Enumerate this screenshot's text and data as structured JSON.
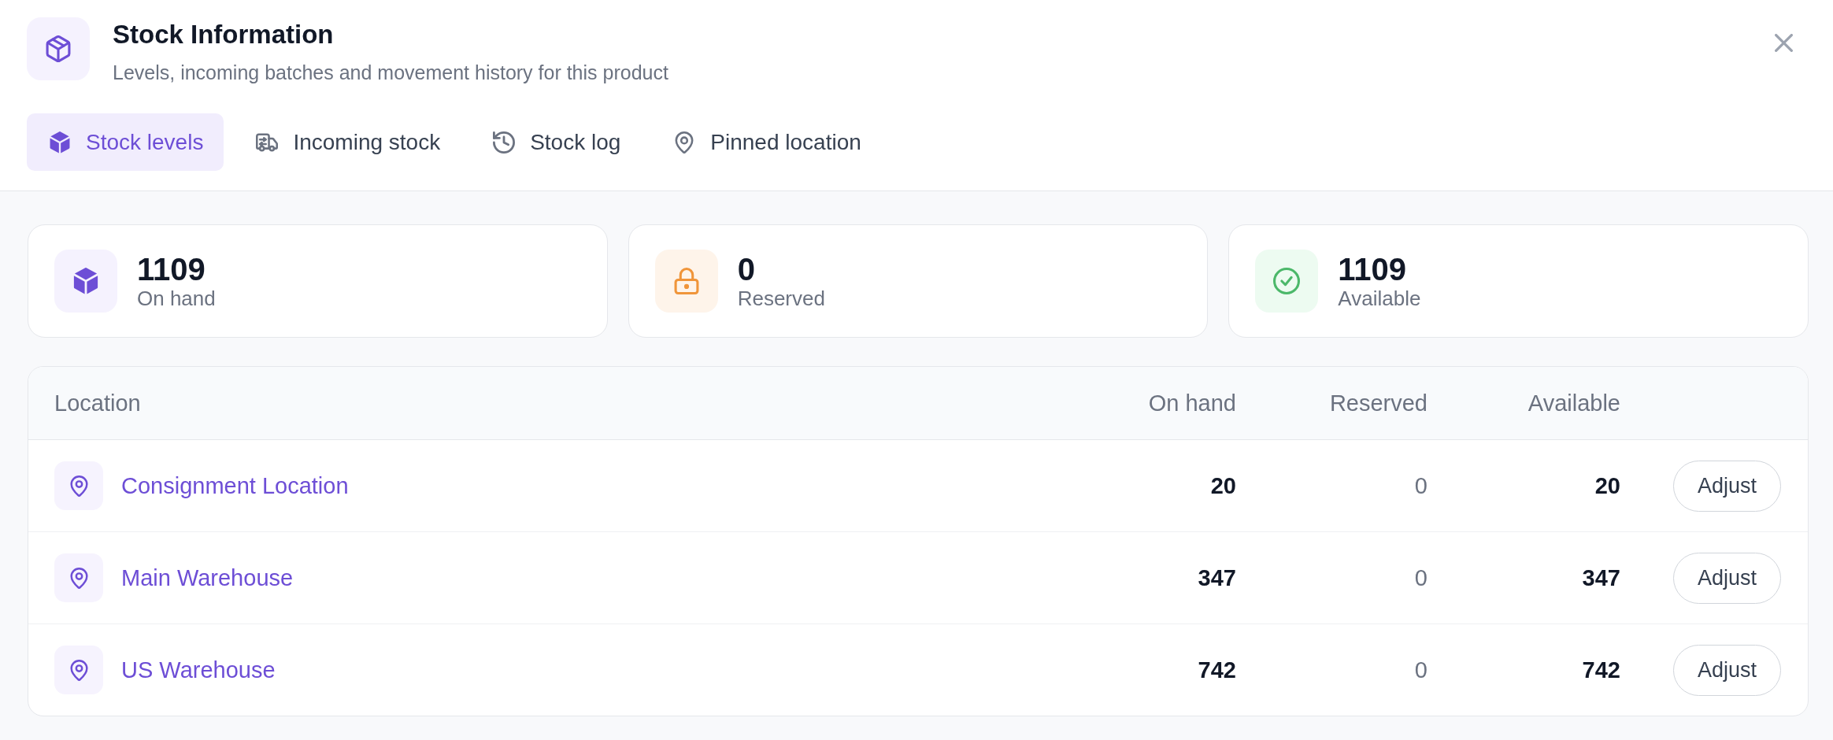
{
  "header": {
    "title": "Stock Information",
    "subtitle": "Levels, incoming batches and movement history for this product"
  },
  "tabs": [
    {
      "label": "Stock levels",
      "kind": "box",
      "selected": true
    },
    {
      "label": "Incoming stock",
      "kind": "truck",
      "selected": false
    },
    {
      "label": "Stock log",
      "kind": "history",
      "selected": false
    },
    {
      "label": "Pinned location",
      "kind": "pin",
      "selected": false
    }
  ],
  "summary": [
    {
      "kind": "total",
      "value": "1109",
      "label": "On hand"
    },
    {
      "kind": "reserved",
      "value": "0",
      "label": "Reserved"
    },
    {
      "kind": "available",
      "value": "1109",
      "label": "Available"
    }
  ],
  "table": {
    "columns": [
      "Location",
      "On hand",
      "Reserved",
      "Available"
    ],
    "rows": [
      {
        "location": "Consignment Location",
        "on_hand": "20",
        "reserved": "0",
        "available": "20",
        "action": "Adjust"
      },
      {
        "location": "Main Warehouse",
        "on_hand": "347",
        "reserved": "0",
        "available": "347",
        "action": "Adjust"
      },
      {
        "location": "US Warehouse",
        "on_hand": "742",
        "reserved": "0",
        "available": "742",
        "action": "Adjust"
      }
    ]
  }
}
